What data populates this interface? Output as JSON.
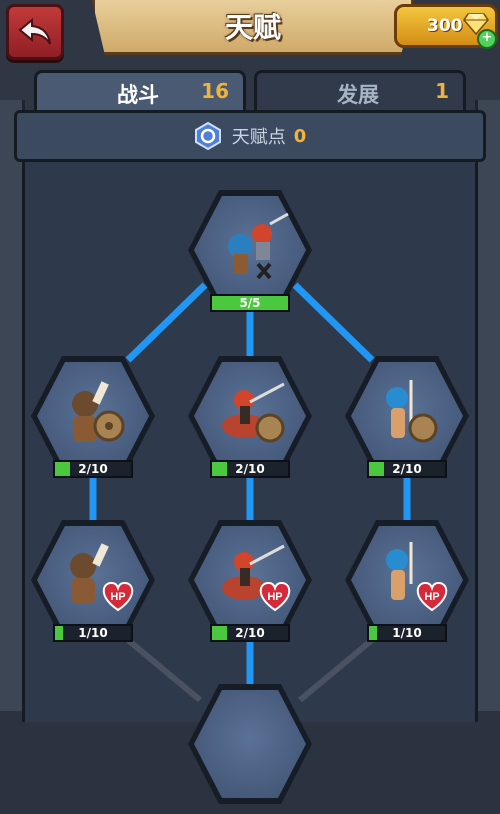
{
  "header": {
    "title": "天赋",
    "gems": "300"
  },
  "tabs": [
    {
      "label": "战斗",
      "count": "16"
    },
    {
      "label": "发展",
      "count": "1"
    }
  ],
  "talent_points": {
    "label": "天赋点",
    "value": "0"
  },
  "colors": {
    "link_active": "#2196f3",
    "link_inactive": "#4a5262",
    "progress_fill": "#4bc93e",
    "accent_gold": "#f0b43a"
  },
  "nodes": {
    "top": {
      "progress": "5/5",
      "fill": 1.0,
      "hero": "squad"
    },
    "r1_left": {
      "progress": "2/10",
      "fill": 0.2,
      "hero": "caveman-shield"
    },
    "r1_mid": {
      "progress": "2/10",
      "fill": 0.2,
      "hero": "rider-shield"
    },
    "r1_right": {
      "progress": "2/10",
      "fill": 0.2,
      "hero": "blue-hair-shield"
    },
    "r2_left": {
      "progress": "1/10",
      "fill": 0.1,
      "hero": "caveman-hp"
    },
    "r2_mid": {
      "progress": "2/10",
      "fill": 0.2,
      "hero": "rider-hp"
    },
    "r2_right": {
      "progress": "1/10",
      "fill": 0.1,
      "hero": "blue-hair-hp"
    }
  },
  "badges": {
    "hp": "HP"
  }
}
